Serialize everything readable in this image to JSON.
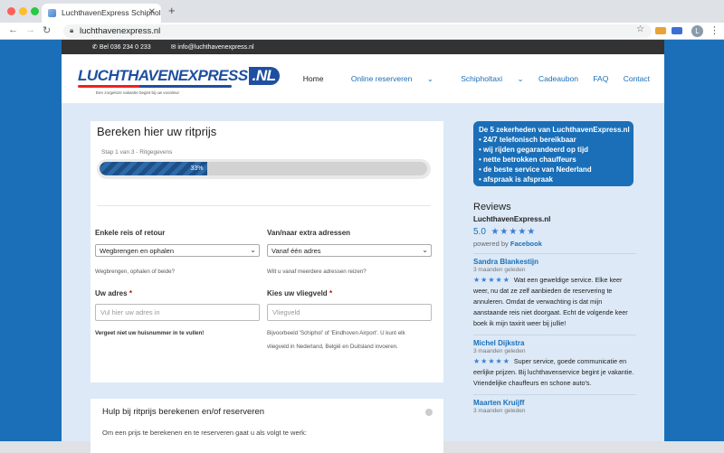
{
  "browser": {
    "tab_title": "LuchthavenExpress Schiphol t",
    "url": "luchthavenexpress.nl"
  },
  "topbar": {
    "phone": "Bel 036 234 0 233",
    "email": "info@luchthavenexpress.nl"
  },
  "header": {
    "logo_text": "LUCHTHAVENEXPRESS",
    "logo_suffix": ".NL",
    "logo_tagline": "Een zorgeloze vakantie begint bij uw voordeur",
    "nav": [
      "Home",
      "Online reserveren",
      "Schipholtaxi",
      "Cadeaubon",
      "FAQ",
      "Contact"
    ]
  },
  "form": {
    "title": "Bereken hier uw ritprijs",
    "step": "Stap 1 van 3 - Ritgegevens",
    "progress_percent": 33,
    "progress_label": "33%",
    "trip_label": "Enkele reis of retour",
    "trip_value": "Wegbrengen en ophalen",
    "trip_hint": "Wegbrengen, ophalen of beide?",
    "addr_label": "Van/naar extra adressen",
    "addr_value": "Vanaf één adres",
    "addr_hint": "Wilt u vanaf meerdere adressen reizen?",
    "your_addr_label": "Uw adres",
    "your_addr_placeholder": "Vul hier uw adres in",
    "your_addr_hint": "Vergeet niet uw huisnummer in te vullen!",
    "airport_label": "Kies uw vliegveld",
    "airport_placeholder": "Vliegveld",
    "airport_hint_1": "Bijvoorbeeld 'Schiphol' of 'Eindhoven Airport'. U kunt elk",
    "airport_hint_2": "vliegveld in Nederland, België en Duitsland invoeren.",
    "required": "*"
  },
  "help": {
    "title": "Hulp bij ritprijs berekenen en/of reserveren",
    "text": "Om een prijs te berekenen en te reserveren gaat u als volgt te werk:"
  },
  "usp": {
    "title": "De 5 zekerheden van LuchthavenExpress.nl",
    "items": [
      "24/7 telefonisch bereikbaar",
      "wij rijden gegarandeerd op tijd",
      "nette betrokken chauffeurs",
      "de beste service van Nederland",
      "afspraak is afspraak"
    ]
  },
  "reviews": {
    "heading": "Reviews",
    "company": "LuchthavenExpress.nl",
    "score": "5.0",
    "stars": "★★★★★",
    "powered_by": "powered by",
    "powered_name": "Facebook",
    "items": [
      {
        "name": "Sandra Blankestijn",
        "date": "3 maanden geleden",
        "text": "Wat een geweldige service. Elke keer weer, nu dat ze zelf aanbieden de reservering te annuleren. Omdat de verwachting is dat mijn aanstaande reis niet doorgaat. Echt de volgende keer boek ik mijn taxirit weer bij jullie!"
      },
      {
        "name": "Michel Dijkstra",
        "date": "3 maanden geleden",
        "text": "Super service, goede communicatie en eerlijke prijzen. Bij luchthavenservice begint je vakantie. Vriendelijke chauffeurs en schone auto's."
      },
      {
        "name": "Maarten Kruijff",
        "date": "3 maanden geleden",
        "text": ""
      }
    ]
  }
}
